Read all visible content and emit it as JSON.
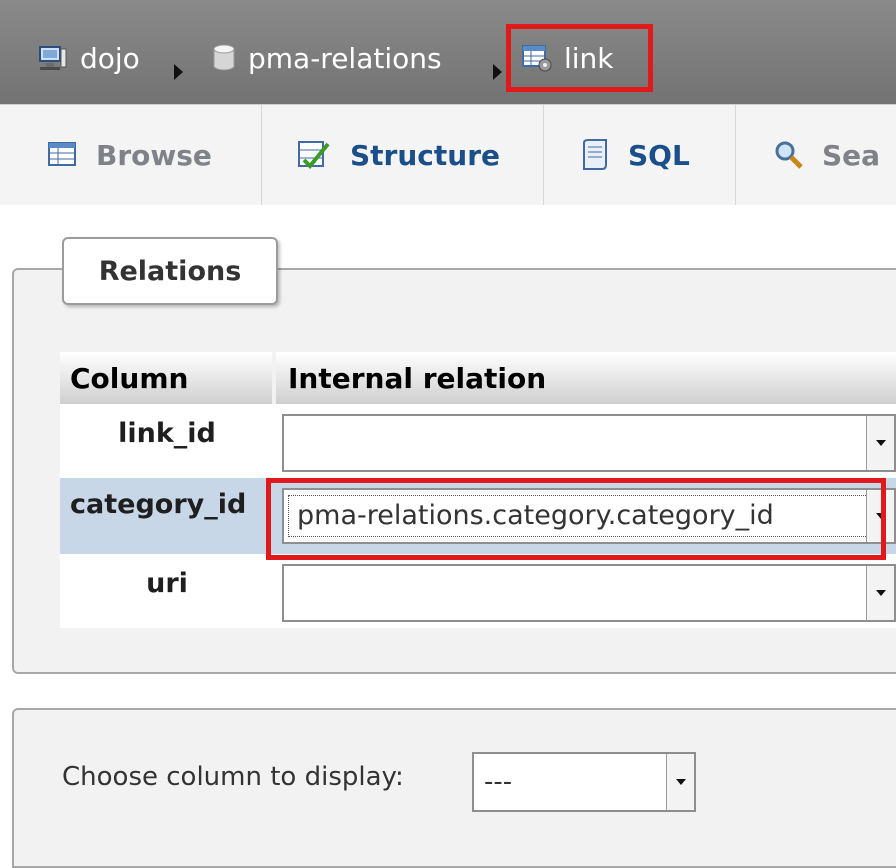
{
  "breadcrumb": {
    "server": "dojo",
    "database": "pma-relations",
    "table": "link"
  },
  "tabs": [
    {
      "label": "Browse",
      "icon": "browse-table-icon"
    },
    {
      "label": "Structure",
      "icon": "structure-icon"
    },
    {
      "label": "SQL",
      "icon": "sql-page-icon"
    },
    {
      "label": "Sea",
      "icon": "search-magnifier-icon"
    }
  ],
  "relations": {
    "legend": "Relations",
    "headers": {
      "column": "Column",
      "internal_relation": "Internal relation"
    },
    "rows": [
      {
        "column": "link_id",
        "value": ""
      },
      {
        "column": "category_id",
        "value": "pma-relations.category.category_id"
      },
      {
        "column": "uri",
        "value": ""
      }
    ]
  },
  "display_column": {
    "label": "Choose column to display:",
    "value": "---"
  },
  "colors": {
    "highlight": "#e2191a",
    "breadcrumb_bg": "#7e7e7e",
    "selected_row": "#c8d7e8"
  }
}
